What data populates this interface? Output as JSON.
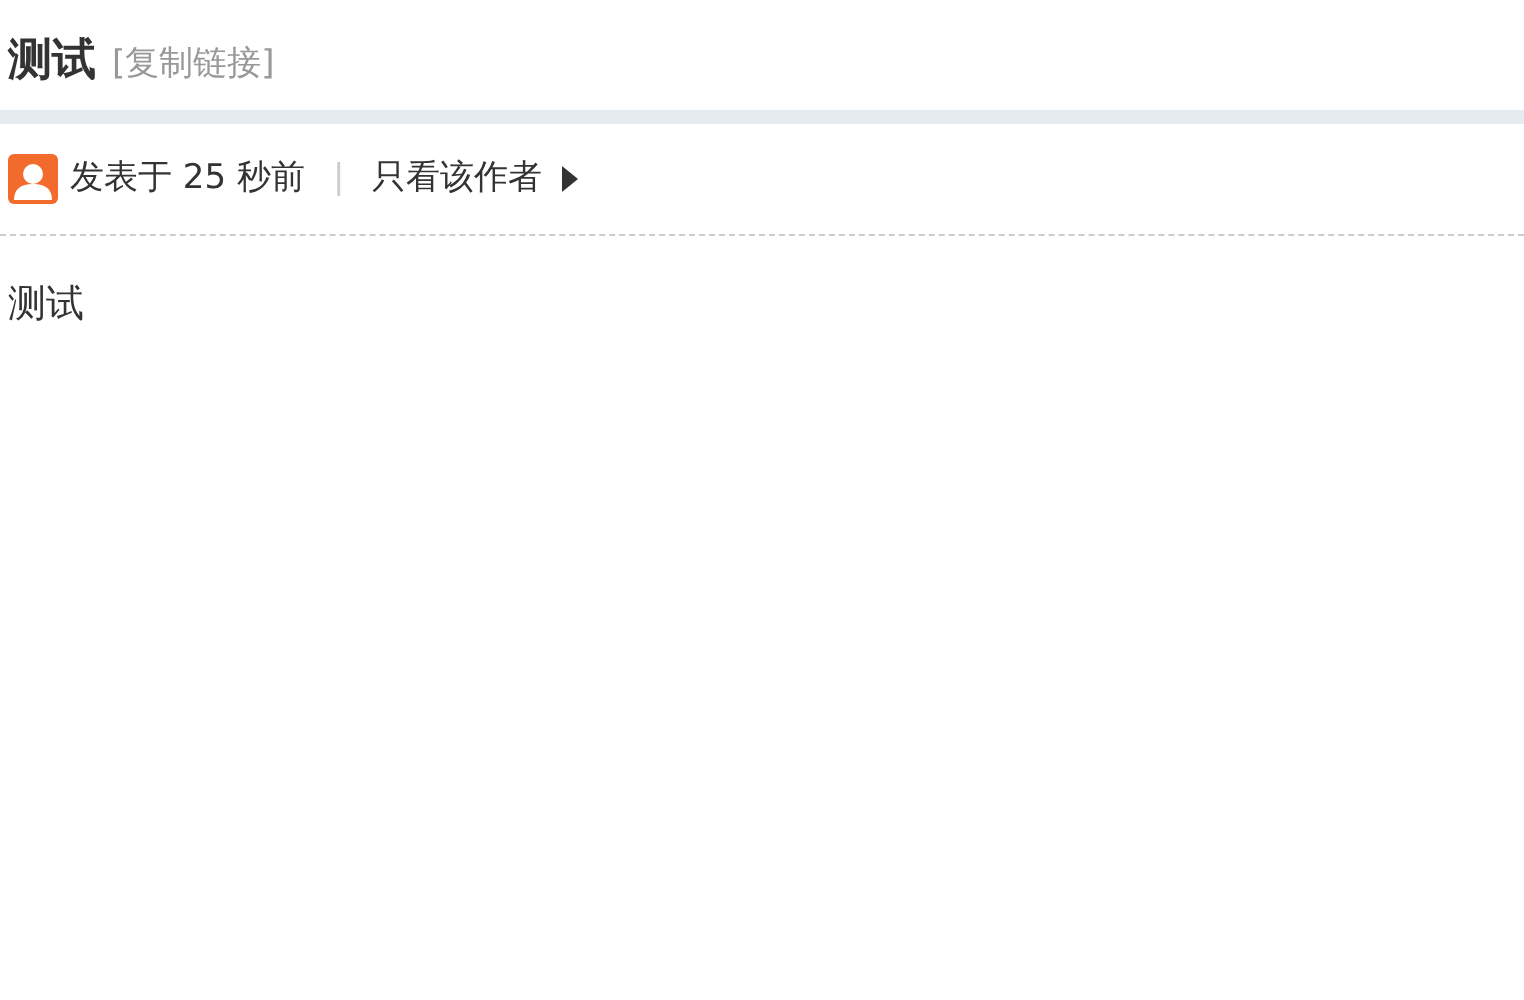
{
  "thread": {
    "title": "测试",
    "copy_link": "[复制链接]"
  },
  "post": {
    "posted": "发表于 25 秒前",
    "separator": "|",
    "only_author": "只看该作者",
    "content": "测试"
  }
}
